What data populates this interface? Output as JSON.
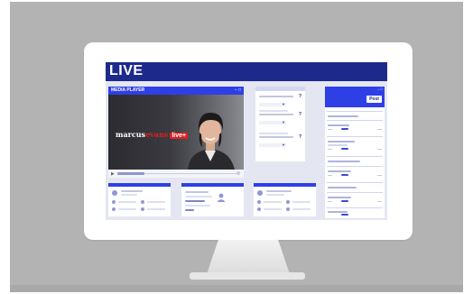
{
  "app": {
    "banner_title": "LIVE"
  },
  "media_player": {
    "title": "MEDIA PLAYER",
    "window_controls": "– □",
    "play_icon": "play-icon",
    "progress": 0.23
  },
  "video": {
    "brand_prefix": "marcus",
    "brand_suffix": "evans",
    "brand_live": "live+"
  },
  "qa_panel": {
    "question_mark": "?"
  },
  "chat": {
    "window_controls": "– □",
    "post_label": "Post"
  },
  "colors": {
    "banner": "#1d2a8c",
    "accent": "#2f3fe6",
    "screen_bg": "#e4e7f2",
    "background": "#b3b3b3"
  }
}
